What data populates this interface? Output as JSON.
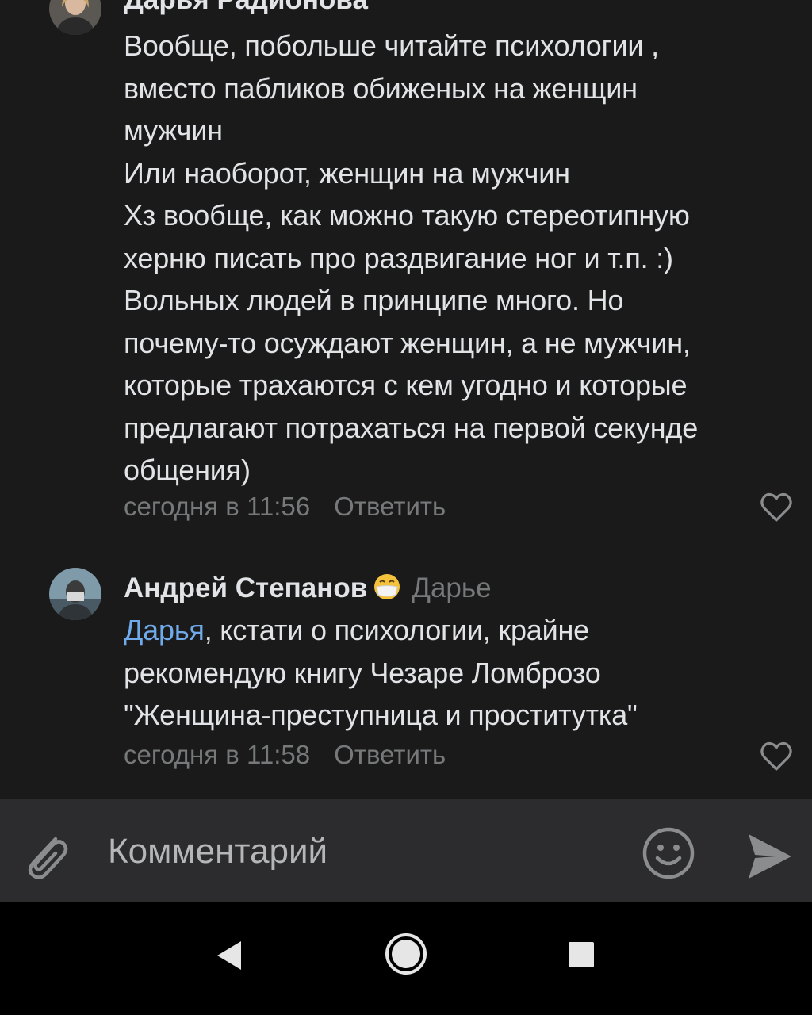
{
  "comments": [
    {
      "author": "Дарья Радионова",
      "text": "Вообще, побольше читайте психологии ,\nвместо пабликов обиженых на женщин\nмужчин\nИли наоборот, женщин на мужчин\nХз вообще, как можно такую стереотипную\nхерню писать про раздвигание ног и т.п. :)\nВольных людей в принципе много. Но\nпочему-то осуждают женщин, а не мужчин,\nкоторые трахаются с кем угодно и которые\nпредлагают потрахаться на первой секунде\nобщения)",
      "time": "сегодня в 11:56",
      "reply_label": "Ответить",
      "avatar_icon": "user-photo-avatar",
      "like_icon": "heart-outline-icon"
    },
    {
      "author": "Андрей Степанов",
      "author_emoji": "face-with-medical-mask-emoji",
      "reply_to": "Дарье",
      "mention": "Дарья",
      "text": ", кстати о психологии, крайне\nрекомендую книгу Чезаре Ломброзо\n\"Женщина-преступница и проститутка\"",
      "time": "сегодня в 11:58",
      "reply_label": "Ответить",
      "avatar_icon": "user-photo-avatar",
      "like_icon": "heart-outline-icon"
    }
  ],
  "composer": {
    "placeholder": "Комментарий",
    "attach_icon": "paperclip-icon",
    "emoji_icon": "smile-icon",
    "send_icon": "send-icon"
  },
  "system_nav": {
    "back_icon": "back-triangle-icon",
    "home_icon": "home-circle-icon",
    "recents_icon": "recents-square-icon"
  },
  "colors": {
    "background": "#1a1a1a",
    "text": "#e1e3e6",
    "secondary": "#76787a",
    "mention": "#71aaeb",
    "composer_bg": "#2c2c2e",
    "navbar_bg": "#000000"
  }
}
